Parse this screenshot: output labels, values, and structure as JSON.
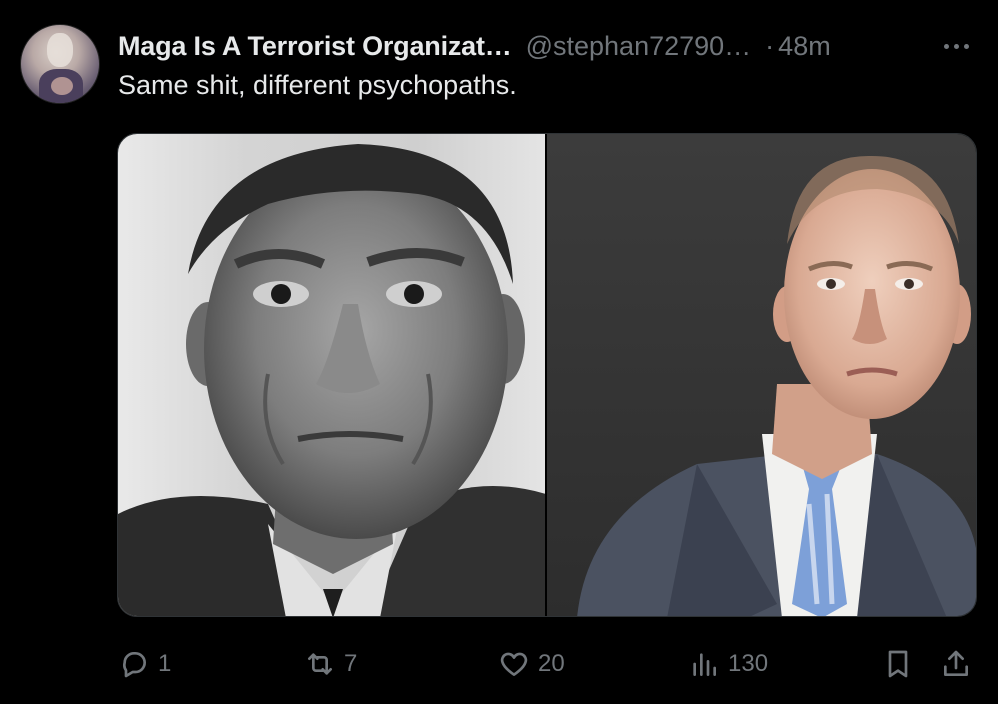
{
  "tweet": {
    "author_name": "Maga Is A Terrorist Organizat…",
    "author_handle": "@stephan72790…",
    "separator": "·",
    "timestamp": "48m",
    "text": "Same shit, different psychopaths."
  },
  "actions": {
    "replies": "1",
    "reposts": "7",
    "likes": "20",
    "views": "130"
  },
  "icons": {
    "reply": "reply-icon",
    "repost": "repost-icon",
    "like": "heart-icon",
    "views": "views-icon",
    "bookmark": "bookmark-icon",
    "share": "share-icon",
    "more": "more-options-icon"
  },
  "colors": {
    "background": "#000000",
    "primary_text": "#e7e9ea",
    "secondary_text": "#71767b",
    "border": "#2f3336"
  }
}
